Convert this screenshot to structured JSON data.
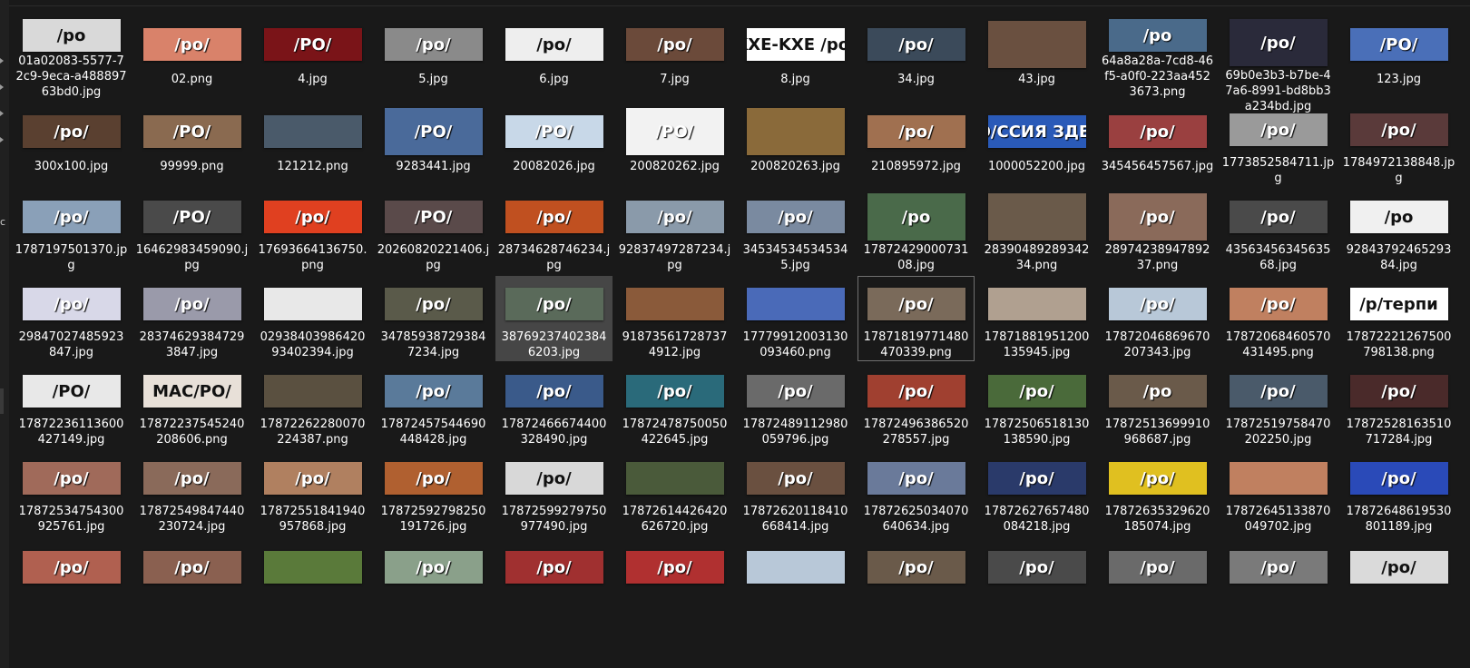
{
  "sidebar": {
    "letter": "c"
  },
  "files": [
    {
      "name": "01a02083-5577-72c9-9eca-a48889763bd0.jpg",
      "overlay": "/po",
      "color": "#d9d9d9",
      "dark": true
    },
    {
      "name": "02.png",
      "overlay": "/po/",
      "color": "#d9826a"
    },
    {
      "name": "4.jpg",
      "overlay": "/PO/",
      "color": "#7a1418"
    },
    {
      "name": "5.jpg",
      "overlay": "/po/",
      "color": "#8a8a8a"
    },
    {
      "name": "6.jpg",
      "overlay": "/po/",
      "color": "#eeeeee",
      "dark": true
    },
    {
      "name": "7.jpg",
      "overlay": "/po/",
      "color": "#6b4a3a"
    },
    {
      "name": "8.jpg",
      "overlay": "KXE-KXE /po/",
      "color": "#ffffff",
      "dark": true
    },
    {
      "name": "34.jpg",
      "overlay": "/po/",
      "color": "#3b4a5a"
    },
    {
      "name": "43.jpg",
      "overlay": "",
      "color": "#6a5040",
      "tall": true
    },
    {
      "name": "64a8a28a-7cd8-46f5-a0f0-223aa4523673.png",
      "overlay": "/po",
      "color": "#4a6a8a"
    },
    {
      "name": "69b0e3b3-b7be-47a6-8991-bd8bb3a234bd.jpg",
      "overlay": "/po/",
      "color": "#2a2a3a",
      "tall": true
    },
    {
      "name": "123.jpg",
      "overlay": "/PO/",
      "color": "#4a6fb8"
    },
    {
      "name": "300x100.jpg",
      "overlay": "/po/",
      "color": "#5a4030"
    },
    {
      "name": "99999.png",
      "overlay": "/PO/",
      "color": "#8a6a50"
    },
    {
      "name": "121212.png",
      "overlay": "",
      "color": "#4a5a6a"
    },
    {
      "name": "9283441.jpg",
      "overlay": "/PO/",
      "color": "#4a6a9a",
      "tall": true
    },
    {
      "name": "20082026.jpg",
      "overlay": "/PO/",
      "color": "#c8d8e8"
    },
    {
      "name": "200820262.jpg",
      "overlay": "/PO/",
      "color": "#f2f2f2",
      "tall": true
    },
    {
      "name": "200820263.jpg",
      "overlay": "",
      "color": "#8a6a3a",
      "tall": true
    },
    {
      "name": "210895972.jpg",
      "overlay": "/po/",
      "color": "#a07050"
    },
    {
      "name": "1000052200.jpg",
      "overlay": "/PO/ССИЯ ЗДЕСЬ",
      "color": "#2a5ab8"
    },
    {
      "name": "345456457567.jpg",
      "overlay": "/po/",
      "color": "#9a4040"
    },
    {
      "name": "1773852584711.jpg",
      "overlay": "/po/",
      "color": "#9a9a9a"
    },
    {
      "name": "1784972138848.jpg",
      "overlay": "/po/",
      "color": "#5a3a3a"
    },
    {
      "name": "1787197501370.jpg",
      "overlay": "/po/",
      "color": "#8aa0b8"
    },
    {
      "name": "16462983459090.jpg",
      "overlay": "/PO/",
      "color": "#4a4a4a"
    },
    {
      "name": "17693664136750.png",
      "overlay": "/po/",
      "color": "#e04020"
    },
    {
      "name": "20260820221406.jpg",
      "overlay": "/PO/",
      "color": "#5a4a4a"
    },
    {
      "name": "28734628746234.jpg",
      "overlay": "/po/",
      "color": "#c05020"
    },
    {
      "name": "92837497287234.jpg",
      "overlay": "/po/",
      "color": "#8a9aaa"
    },
    {
      "name": "345345345345345.jpg",
      "overlay": "/po/",
      "color": "#7a8aa0"
    },
    {
      "name": "1787242900073108.jpg",
      "overlay": "/po",
      "color": "#4a6a4a",
      "tall": true
    },
    {
      "name": "2839048928934234.png",
      "overlay": "",
      "color": "#6a5a4a",
      "tall": true
    },
    {
      "name": "2897423894789237.png",
      "overlay": "/po/",
      "color": "#8a6a5a",
      "tall": true
    },
    {
      "name": "4356345634563568.jpg",
      "overlay": "/po/",
      "color": "#4a4a4a"
    },
    {
      "name": "9284379246529384.jpg",
      "overlay": "/po",
      "color": "#f0f0f0",
      "dark": true
    },
    {
      "name": "29847027485923847.jpg",
      "overlay": "/po/",
      "color": "#d8d8e8"
    },
    {
      "name": "283746293847293847.jpg",
      "overlay": "/po/",
      "color": "#9a9aaa"
    },
    {
      "name": "0293840398642093402394.jpg",
      "overlay": "",
      "color": "#e8e8e8"
    },
    {
      "name": "347859387293847234.jpg",
      "overlay": "/po/",
      "color": "#5a5a4a"
    },
    {
      "name": "387692374023846203.jpg",
      "overlay": "/po/",
      "color": "#5a6a5a"
    },
    {
      "name": "918735617287374912.jpg",
      "overlay": "",
      "color": "#8a5a3a"
    },
    {
      "name": "17779912003130093460.png",
      "overlay": "",
      "color": "#4a6ab8"
    },
    {
      "name": "17871819771480470339.png",
      "overlay": "/po/",
      "color": "#7a6a5a"
    },
    {
      "name": "17871881951200135945.jpg",
      "overlay": "",
      "color": "#b0a090"
    },
    {
      "name": "17872046869670207343.jpg",
      "overlay": "/po/",
      "color": "#b8c8d8"
    },
    {
      "name": "17872068460570431495.png",
      "overlay": "/po/",
      "color": "#c08060"
    },
    {
      "name": "17872221267500798138.png",
      "overlay": "/р/терпи",
      "color": "#ffffff",
      "dark": true
    },
    {
      "name": "17872236113600427149.jpg",
      "overlay": "/PO/",
      "color": "#e8e8e8",
      "dark": true
    },
    {
      "name": "17872237545240208606.png",
      "overlay": "MAC/PO/",
      "color": "#e8e0d8",
      "dark": true
    },
    {
      "name": "17872262280070224387.png",
      "overlay": "",
      "color": "#5a5040"
    },
    {
      "name": "17872457544690448428.jpg",
      "overlay": "/po/",
      "color": "#5a7a9a"
    },
    {
      "name": "17872466674400328490.jpg",
      "overlay": "/po/",
      "color": "#3a5a8a"
    },
    {
      "name": "17872478750050422645.jpg",
      "overlay": "/po/",
      "color": "#2a6a7a"
    },
    {
      "name": "17872489112980059796.jpg",
      "overlay": "/po/",
      "color": "#6a6a6a"
    },
    {
      "name": "17872496386520278557.jpg",
      "overlay": "/po/",
      "color": "#a04030"
    },
    {
      "name": "17872506518130138590.jpg",
      "overlay": "/po/",
      "color": "#4a6a3a"
    },
    {
      "name": "17872513699910968687.jpg",
      "overlay": "/po",
      "color": "#6a5a4a"
    },
    {
      "name": "17872519758470202250.jpg",
      "overlay": "/po/",
      "color": "#4a5a6a"
    },
    {
      "name": "17872528163510717284.jpg",
      "overlay": "/po/",
      "color": "#4a2a2a"
    },
    {
      "name": "17872534754300925761.jpg",
      "overlay": "/po/",
      "color": "#a06a5a"
    },
    {
      "name": "17872549847440230724.jpg",
      "overlay": "/po/",
      "color": "#8a6a5a"
    },
    {
      "name": "17872551841940957868.jpg",
      "overlay": "/po/",
      "color": "#b08060"
    },
    {
      "name": "17872592798250191726.jpg",
      "overlay": "/po/",
      "color": "#b06030"
    },
    {
      "name": "17872599279750977490.jpg",
      "overlay": "/po/",
      "color": "#d8d8d8",
      "dark": true
    },
    {
      "name": "17872614426420626720.jpg",
      "overlay": "",
      "color": "#4a5a3a"
    },
    {
      "name": "17872620118410668414.jpg",
      "overlay": "/po/",
      "color": "#6a5040"
    },
    {
      "name": "17872625034070640634.jpg",
      "overlay": "/po/",
      "color": "#6a7a9a"
    },
    {
      "name": "17872627657480084218.jpg",
      "overlay": "/po/",
      "color": "#2a3a6a"
    },
    {
      "name": "17872635329620185074.jpg",
      "overlay": "/po/",
      "color": "#e0c020"
    },
    {
      "name": "17872645133870049702.jpg",
      "overlay": "",
      "color": "#c08060"
    },
    {
      "name": "17872648619530801189.jpg",
      "overlay": "/po/",
      "color": "#2a4ab8"
    },
    {
      "name": "",
      "overlay": "/po/",
      "color": "#b06050"
    },
    {
      "name": "",
      "overlay": "/po/",
      "color": "#8a6050"
    },
    {
      "name": "",
      "overlay": "",
      "color": "#5a7a3a"
    },
    {
      "name": "",
      "overlay": "/po/",
      "color": "#8aa08a"
    },
    {
      "name": "",
      "overlay": "/po/",
      "color": "#a03030"
    },
    {
      "name": "",
      "overlay": "/po/",
      "color": "#b03030"
    },
    {
      "name": "",
      "overlay": "",
      "color": "#b8c8d8"
    },
    {
      "name": "",
      "overlay": "/po/",
      "color": "#6a5a4a"
    },
    {
      "name": "",
      "overlay": "/po/",
      "color": "#4a4a4a"
    },
    {
      "name": "",
      "overlay": "/po/",
      "color": "#6a6a6a"
    },
    {
      "name": "",
      "overlay": "/po/",
      "color": "#7a7a7a"
    },
    {
      "name": "",
      "overlay": "/po/",
      "color": "#dadada",
      "dark": true
    }
  ],
  "selected_index": 40,
  "focused_index": 43
}
